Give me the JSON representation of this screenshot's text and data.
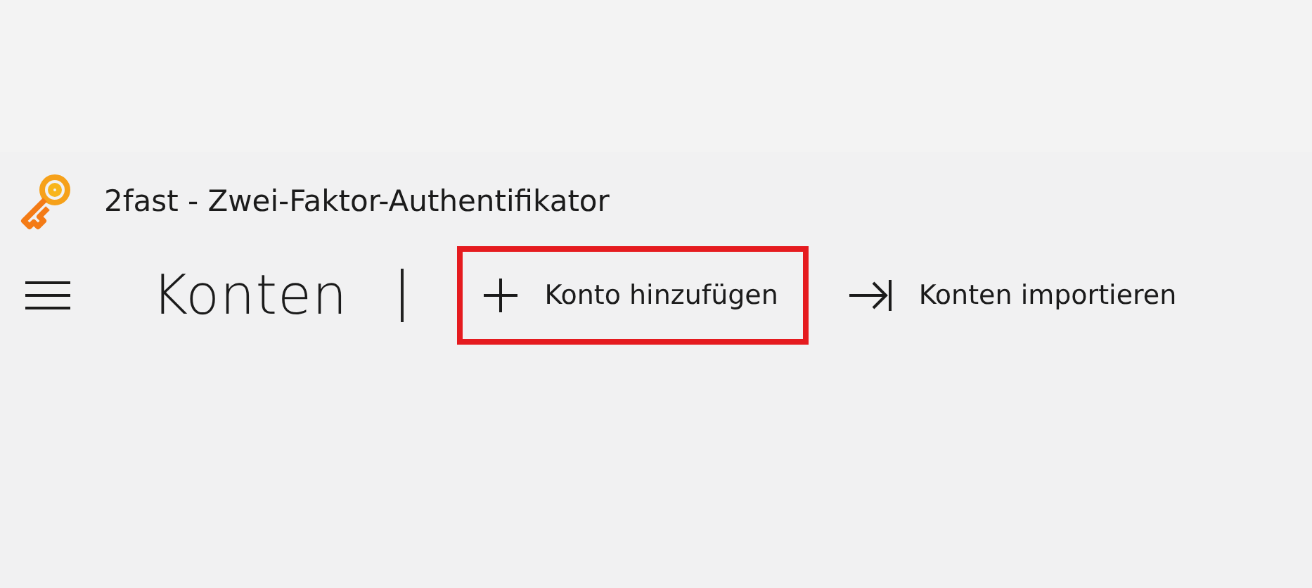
{
  "window": {
    "title": "2fast - Zwei-Faktor-Authentifikator"
  },
  "header": {
    "title": "Konten"
  },
  "actions": [
    {
      "kind": "add",
      "label": "Konto hinzufügen",
      "highlighted": true
    },
    {
      "kind": "import",
      "label": "Konten importieren",
      "highlighted": false
    }
  ]
}
